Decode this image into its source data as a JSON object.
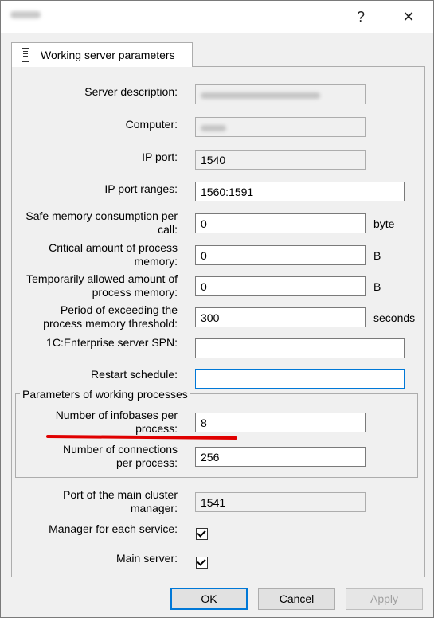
{
  "titlebar": {
    "help": "?",
    "close": "✕"
  },
  "tab": {
    "label": "Working server parameters"
  },
  "fields": {
    "server_description": {
      "label": "Server description:"
    },
    "computer": {
      "label": "Computer:"
    },
    "ip_port": {
      "label": "IP port:",
      "value": "1540"
    },
    "ip_port_ranges": {
      "label": "IP port ranges:",
      "value": "1560:1591"
    },
    "safe_memory": {
      "label1": "Safe memory consumption per",
      "label2": "call:",
      "value": "0",
      "unit": "byte"
    },
    "critical_memory": {
      "label1": "Critical amount of process",
      "label2": "memory:",
      "value": "0",
      "unit": "B"
    },
    "temp_memory": {
      "label1": "Temporarily allowed amount of",
      "label2": "process memory:",
      "value": "0",
      "unit": "B"
    },
    "period_exceeding": {
      "label1": "Period of exceeding the",
      "label2": "process memory threshold:",
      "value": "300",
      "unit": "seconds"
    },
    "spn": {
      "label": "1C:Enterprise server SPN:",
      "value": ""
    },
    "restart_schedule": {
      "label": "Restart schedule:",
      "value": ""
    }
  },
  "group": {
    "title": "Parameters of working processes",
    "infobases": {
      "label1": "Number of infobases per",
      "label2": "process:",
      "value": "8"
    },
    "connections": {
      "label1": "Number of connections",
      "label2": "per process:",
      "value": "256"
    }
  },
  "cluster": {
    "port": {
      "label1": "Port of the main cluster",
      "label2": "manager:",
      "value": "1541"
    },
    "manager_each": {
      "label": "Manager for each service:",
      "checked": true
    },
    "main_server": {
      "label": "Main server:",
      "checked": true
    }
  },
  "buttons": {
    "ok": "OK",
    "cancel": "Cancel",
    "apply": "Apply"
  }
}
